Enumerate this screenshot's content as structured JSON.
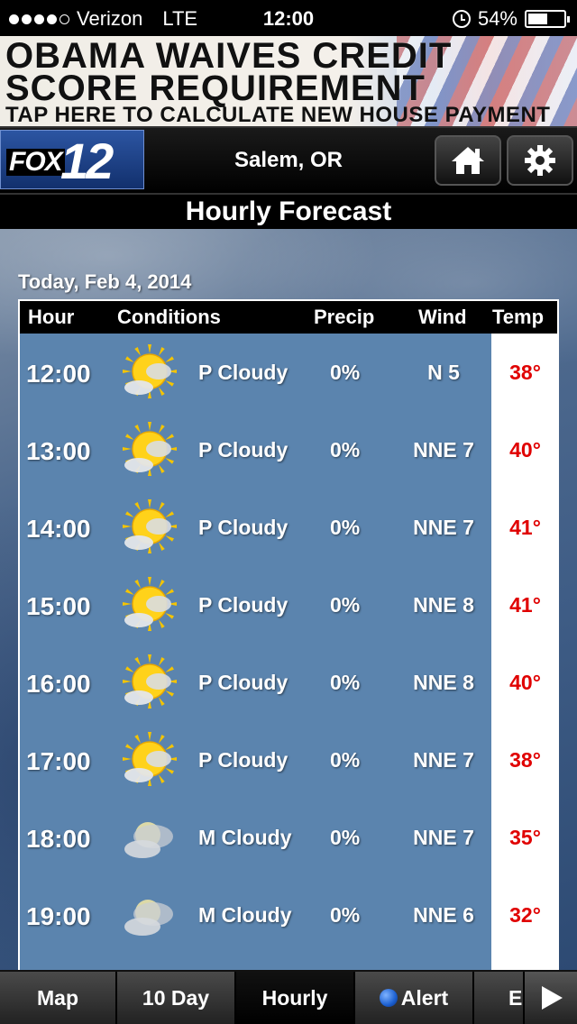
{
  "status_bar": {
    "carrier": "Verizon",
    "network": "LTE",
    "time": "12:00",
    "battery_percent_label": "54%",
    "battery_level": 0.54,
    "signal_bars": 4
  },
  "ad": {
    "line1": "OBAMA WAIVES CREDIT",
    "line2": "SCORE REQUIREMENT",
    "line3": "TAP HERE TO CALCULATE NEW HOUSE PAYMENT"
  },
  "header": {
    "logo_fox": "FOX",
    "logo_number": "12",
    "location": "Salem, OR",
    "icons": [
      "home-icon",
      "gear-icon"
    ]
  },
  "page_title": "Hourly Forecast",
  "date": "Today, Feb 4, 2014",
  "table": {
    "headers": {
      "hour": "Hour",
      "conditions": "Conditions",
      "precip": "Precip",
      "wind": "Wind",
      "temp": "Temp"
    },
    "rows": [
      {
        "hour": "12:00",
        "icon": "partly-cloudy",
        "conditions": "P Cloudy",
        "precip": "0%",
        "wind": "N 5",
        "temp": "38°"
      },
      {
        "hour": "13:00",
        "icon": "partly-cloudy",
        "conditions": "P Cloudy",
        "precip": "0%",
        "wind": "NNE 7",
        "temp": "40°"
      },
      {
        "hour": "14:00",
        "icon": "partly-cloudy",
        "conditions": "P Cloudy",
        "precip": "0%",
        "wind": "NNE 7",
        "temp": "41°"
      },
      {
        "hour": "15:00",
        "icon": "partly-cloudy",
        "conditions": "P Cloudy",
        "precip": "0%",
        "wind": "NNE 8",
        "temp": "41°"
      },
      {
        "hour": "16:00",
        "icon": "partly-cloudy",
        "conditions": "P Cloudy",
        "precip": "0%",
        "wind": "NNE 8",
        "temp": "40°"
      },
      {
        "hour": "17:00",
        "icon": "partly-cloudy",
        "conditions": "P Cloudy",
        "precip": "0%",
        "wind": "NNE 7",
        "temp": "38°"
      },
      {
        "hour": "18:00",
        "icon": "mostly-cloudy",
        "conditions": "M Cloudy",
        "precip": "0%",
        "wind": "NNE 7",
        "temp": "35°"
      },
      {
        "hour": "19:00",
        "icon": "mostly-cloudy",
        "conditions": "M Cloudy",
        "precip": "0%",
        "wind": "NNE 6",
        "temp": "32°"
      }
    ]
  },
  "tabs": {
    "map": "Map",
    "ten_day": "10 Day",
    "hourly": "Hourly",
    "alert": "Alert",
    "more": "E"
  },
  "colors": {
    "row_bg": "#5b84ae",
    "temp_text": "#e00000",
    "header_bg": "#000000"
  }
}
